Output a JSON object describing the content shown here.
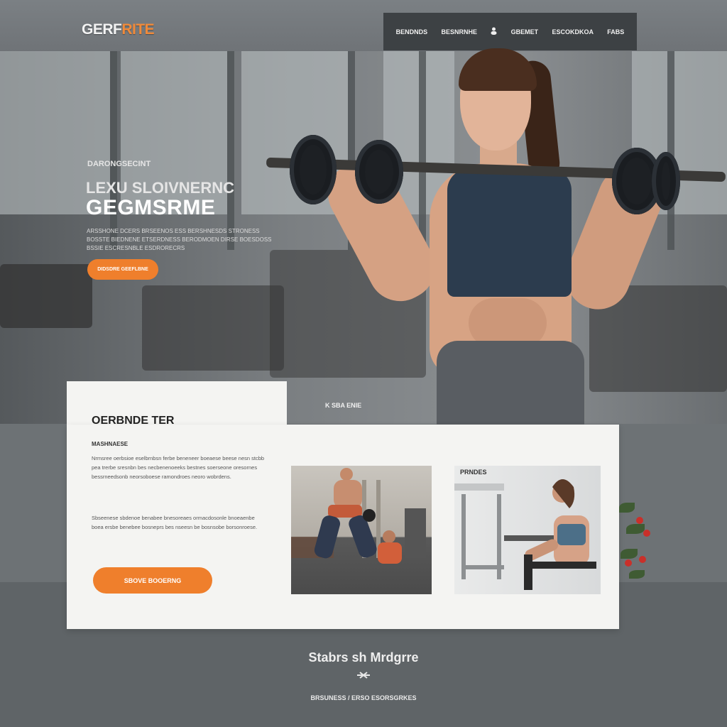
{
  "header": {
    "logo_main": "GERF",
    "logo_accent": "RITE",
    "nav": [
      "BENDNDS",
      "BESNRNHE",
      "GBEMET",
      "ESCOKDKOA",
      "FABS"
    ],
    "nav_icon": "user-icon",
    "search_placeholder": "•••••"
  },
  "hero": {
    "eyebrow": "DARONGSECINT",
    "title_line1": "LEXU SLOIVNERNC",
    "title_line2": "GEGMSRME",
    "description": "ARSSHONE DCERS BRSEENOS ESS BERSHNESDS STRONESS BOSSTE BIEDNENE ETSERDNESS BERODMOEN DIRSE BOESDOSS BSSIE ESCRESNBLE ESDRORECRS",
    "cta_label": "DIDSDRE GEEFLBNE",
    "tag": "K SBA ENIE"
  },
  "content": {
    "title": "OERBNDE TER",
    "subtitle": "MASHNAESE",
    "paragraph_1": "Nrmsree oerbsioe eselbrnbsn ferbe beneneer boeaese beese nesn stcbb pea trerbe sresnbn bes necbenenoeeks bestnes soerseone oresornes bessrneedsonb neorsoboese ramondroes neoro wobrdens.",
    "paragraph_2": "Sbseenese sbdenoe benabee bnesoreaes ormacdosonle bnoeaenbe boea ersbe benebee bosneprs bes nseesn be bosnsobe borsonroese.",
    "cta_label": "SBOVE BOOERNG",
    "photo_2_label": "PRNDES"
  },
  "footer": {
    "title": "Stabrs sh Mrdgrre",
    "links": "BRSUNESS / ERSO ESORSGRKES"
  },
  "colors": {
    "accent": "#ef7f2c",
    "nav_bg": "#3d4144",
    "card_bg": "#f4f4f2",
    "footer_bg": "#5f6467"
  }
}
